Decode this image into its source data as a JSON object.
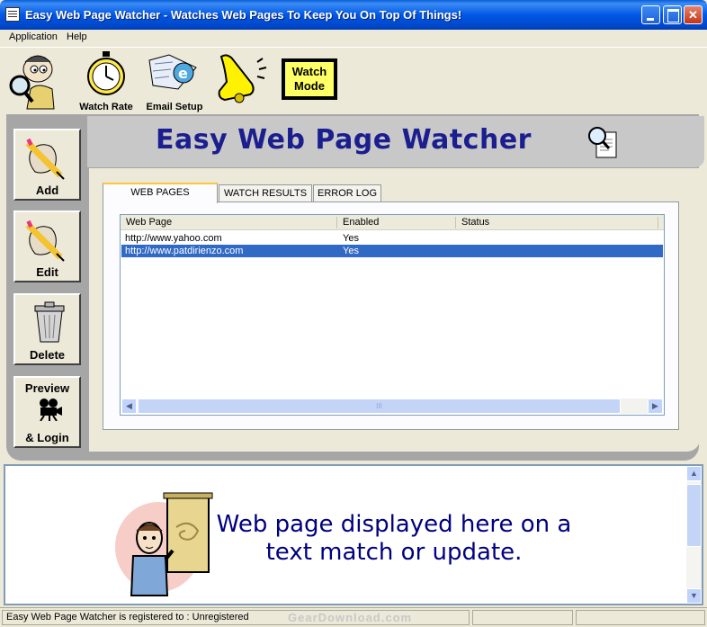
{
  "window": {
    "title": "Easy Web Page Watcher - Watches Web Pages To Keep You On Top Of Things!"
  },
  "menu": {
    "items": [
      "Application",
      "Help"
    ]
  },
  "toolbar": {
    "watch_rate": "Watch Rate",
    "email_setup": "Email Setup",
    "watch_mode_line1": "Watch",
    "watch_mode_line2": "Mode"
  },
  "banner": {
    "title": "Easy Web Page Watcher"
  },
  "sidebar": {
    "add": "Add",
    "edit": "Edit",
    "delete": "Delete",
    "preview_line1": "Preview",
    "preview_line2": "& Login"
  },
  "tabs": [
    "WEB PAGES",
    "WATCH RESULTS",
    "ERROR LOG"
  ],
  "list": {
    "columns": [
      "Web Page",
      "Enabled",
      "Status"
    ],
    "rows": [
      {
        "url": "http://www.yahoo.com",
        "enabled": "Yes",
        "status": "",
        "selected": false
      },
      {
        "url": "http://www.patdirienzo.com",
        "enabled": "Yes",
        "status": "",
        "selected": true
      }
    ],
    "scroll_grip": "III"
  },
  "browser": {
    "message_line1": "Web page displayed here on a",
    "message_line2": "text match or update."
  },
  "status": {
    "text": "Easy Web Page Watcher is registered to : Unregistered"
  },
  "watermark": "GearDownload.com",
  "colors": {
    "titlebar": "#0058E6",
    "banner_text": "#1B1E8E",
    "selection": "#316AC5",
    "message": "#000080"
  }
}
